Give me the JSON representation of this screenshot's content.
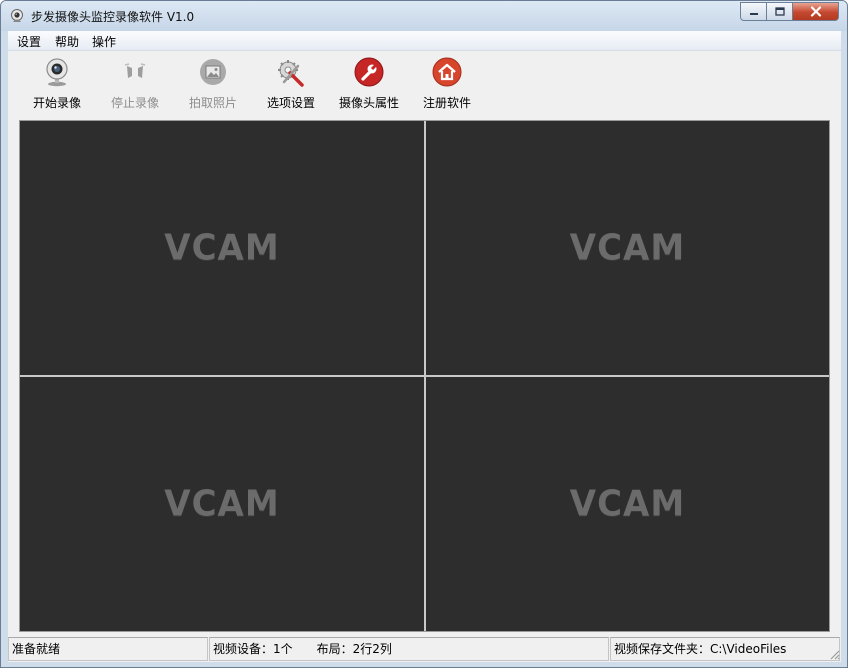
{
  "window": {
    "title": "步发摄像头监控录像软件 V1.0",
    "controls": {
      "minimize": "minimize",
      "maximize": "maximize",
      "close": "close"
    }
  },
  "menubar": {
    "items": [
      {
        "label": "设置"
      },
      {
        "label": "帮助"
      },
      {
        "label": "操作"
      }
    ]
  },
  "toolbar": {
    "buttons": [
      {
        "label": "开始录像",
        "icon": "webcam-icon",
        "enabled": true
      },
      {
        "label": "停止录像",
        "icon": "stop-recording-icon",
        "enabled": false
      },
      {
        "label": "拍取照片",
        "icon": "photo-icon",
        "enabled": false
      },
      {
        "label": "选项设置",
        "icon": "settings-tools-icon",
        "enabled": true
      },
      {
        "label": "摄像头属性",
        "icon": "wrench-icon",
        "enabled": true
      },
      {
        "label": "注册软件",
        "icon": "home-icon",
        "enabled": true
      }
    ]
  },
  "video_grid": {
    "rows": 2,
    "cols": 2,
    "cells": [
      {
        "placeholder": "VCAM"
      },
      {
        "placeholder": "VCAM"
      },
      {
        "placeholder": "VCAM"
      },
      {
        "placeholder": "VCAM"
      }
    ]
  },
  "statusbar": {
    "status": "准备就绪",
    "device_info": "视频设备：1个　　布局：2行2列",
    "save_folder": "视频保存文件夹：C:\\VideoFiles"
  },
  "colors": {
    "video_bg": "#2d2d2d",
    "close_button": "#c5472f",
    "wrench_icon": "#c62626",
    "home_icon": "#d8452d"
  }
}
